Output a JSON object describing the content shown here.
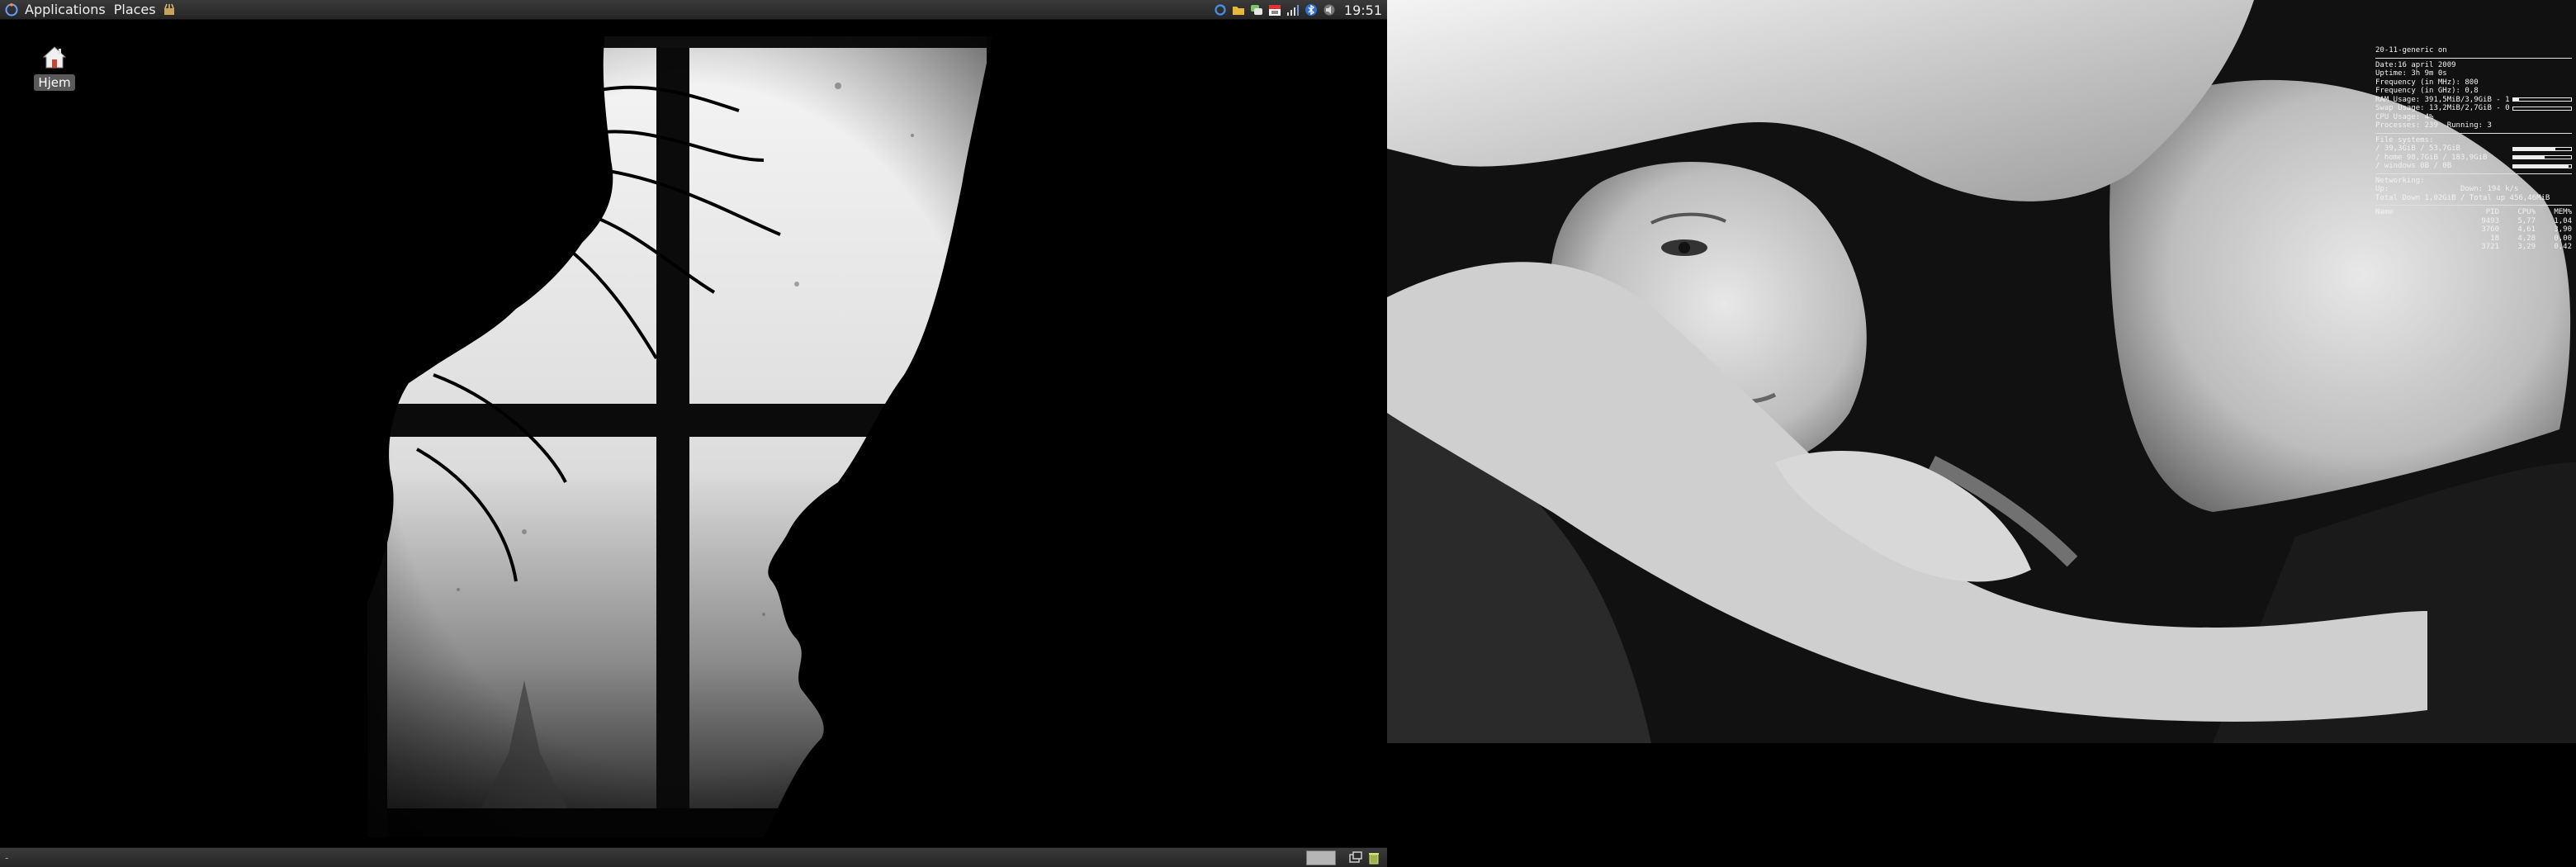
{
  "top_panel": {
    "menus": [
      {
        "label": "Applications"
      },
      {
        "label": "Places"
      }
    ],
    "tray_icons": [
      "sync-icon",
      "folder-icon",
      "chat-icon",
      "calendar-icon",
      "signal-icon",
      "bluetooth-icon",
      "volume-icon"
    ],
    "clock": "19:51"
  },
  "desktop": {
    "icons": [
      {
        "label": "Hjem",
        "icon": "home-icon"
      }
    ]
  },
  "bottom_panel": {
    "mark": "-",
    "icons": [
      "show-desktop-icon",
      "trash-icon"
    ]
  },
  "conky": {
    "title": "20-11-generic on",
    "info_lines": [
      "Date:16 april 2009",
      "Uptime: 3h 9m 0s",
      "Frequency (in MHz): 800",
      "Frequency (in GHz): 0,8"
    ],
    "ram_line": "RAM Usage: 391,5MiB/3,9GiB - 10%",
    "ram_fraction": 0.1,
    "swap_line": "Swap Usage: 13,2MiB/2,7GiB - 0%",
    "swap_fraction": 0.0,
    "cpu_line": "CPU Usage: 4%",
    "process_line": "Processes: 239  Running: 3",
    "fs_title": "File systems:",
    "fs": [
      {
        "line": "/ 39,3GiB / 53,7GiB",
        "fraction": 0.73
      },
      {
        "line": "/ home 98,7GiB / 183,9GiB",
        "fraction": 0.54
      },
      {
        "line": "/ windows 0B / 0B",
        "fraction": 0.95
      }
    ],
    "net_title": "Networking:",
    "net_lines": [
      "Up:                Down: 194 k/s",
      "Total Down 1,02GiB / Total up 456,46MiB"
    ],
    "proc_header": {
      "name": "Name",
      "pid": "PID",
      "cpu": "CPU%",
      "mem": "MEM%"
    },
    "processes": [
      {
        "name": "",
        "pid": "9493",
        "cpu": "5,77",
        "mem": "1,04"
      },
      {
        "name": "",
        "pid": "3760",
        "cpu": "4,61",
        "mem": "3,90"
      },
      {
        "name": "",
        "pid": "18",
        "cpu": "4,28",
        "mem": "0,00"
      },
      {
        "name": "",
        "pid": "3721",
        "cpu": "3,29",
        "mem": "0,42"
      }
    ]
  }
}
